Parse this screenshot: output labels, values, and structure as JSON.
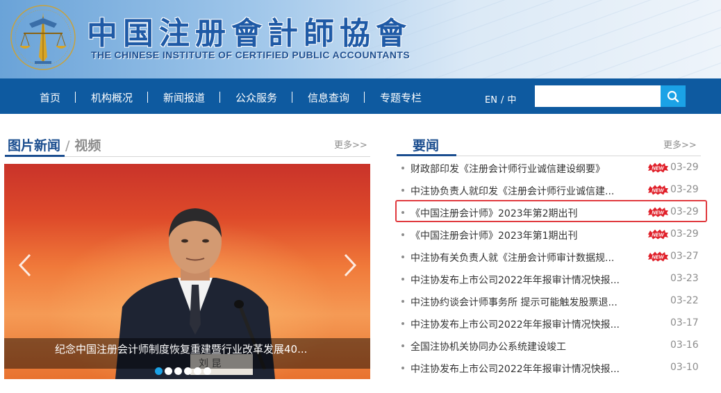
{
  "header": {
    "cn_title": "中国注册會計師協會",
    "en_title": "THE CHINESE INSTITUTE OF CERTIFIED PUBLIC ACCOUNTANTS",
    "logo_icon": "scales-of-justice-emblem-icon"
  },
  "nav": {
    "items": [
      {
        "label": "首页"
      },
      {
        "label": "机构概况"
      },
      {
        "label": "新闻报道"
      },
      {
        "label": "公众服务"
      },
      {
        "label": "信息查询"
      },
      {
        "label": "专题专栏"
      }
    ],
    "lang_en": "EN",
    "lang_sep": "/",
    "lang_cn": "中",
    "search": {
      "value": "",
      "placeholder": "",
      "icon": "search-icon"
    }
  },
  "photo_news": {
    "tab_active": "图片新闻",
    "tab_sep": "/",
    "tab_inactive": "视频",
    "more": "更多>>",
    "caption": "纪念中国注册会计师制度恢复重建暨行业改革发展40...",
    "nameplate": "刘 昆",
    "dots_total": 6,
    "dot_active_index": 0
  },
  "headline_news": {
    "title": "要闻",
    "more": "更多>>",
    "items": [
      {
        "title": "财政部印发《注册会计师行业诚信建设纲要》",
        "date": "03-29",
        "is_new": true
      },
      {
        "title": "中注协负责人就印发《注册会计师行业诚信建...",
        "date": "03-29",
        "is_new": true
      },
      {
        "title": "《中国注册会计师》2023年第2期出刊",
        "date": "03-29",
        "is_new": true
      },
      {
        "title": "《中国注册会计师》2023年第1期出刊",
        "date": "03-29",
        "is_new": true
      },
      {
        "title": "中注协有关负责人就《注册会计师审计数据规...",
        "date": "03-27",
        "is_new": true
      },
      {
        "title": "中注协发布上市公司2022年年报审计情况快报...",
        "date": "03-23",
        "is_new": false
      },
      {
        "title": "中注协约谈会计师事务所 提示可能触发股票退...",
        "date": "03-22",
        "is_new": false
      },
      {
        "title": "中注协发布上市公司2022年年报审计情况快报...",
        "date": "03-17",
        "is_new": false
      },
      {
        "title": "全国注协机关协同办公系统建设竣工",
        "date": "03-16",
        "is_new": false
      },
      {
        "title": "中注协发布上市公司2022年年报审计情况快报...",
        "date": "03-10",
        "is_new": false
      }
    ],
    "new_badge_label": "NEW"
  },
  "colors": {
    "nav_bg": "#0e5aa0",
    "accent_blue": "#1a4d8f",
    "search_btn": "#1ba2e6",
    "highlight": "#e0393e",
    "new_badge": "#e0202a"
  }
}
